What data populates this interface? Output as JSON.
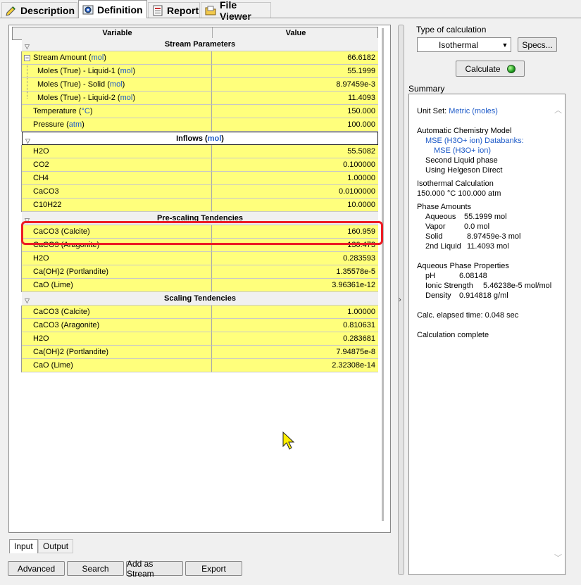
{
  "tabs": [
    {
      "label": "Description",
      "icon": "pencil-tag-icon"
    },
    {
      "label": "Definition",
      "icon": "gear-icon"
    },
    {
      "label": "Report",
      "icon": "report-icon"
    },
    {
      "label": "File Viewer",
      "icon": "folder-icon"
    }
  ],
  "grid": {
    "col_variable": "Variable",
    "col_value": "Value",
    "stream_section": "Stream Parameters",
    "stream_rows": [
      {
        "label": "Stream Amount",
        "unit": "mol",
        "value": "66.6182"
      },
      {
        "label": "Moles (True) - Liquid-1",
        "unit": "mol",
        "value": "55.1999"
      },
      {
        "label": "Moles (True) - Solid",
        "unit": "mol",
        "value": "8.97459e-3"
      },
      {
        "label": "Moles (True) - Liquid-2",
        "unit": "mol",
        "value": "11.4093"
      },
      {
        "label": "Temperature",
        "unit": "°C",
        "value": "150.000"
      },
      {
        "label": "Pressure",
        "unit": "atm",
        "value": "100.000"
      }
    ],
    "inflows_section": "Inflows",
    "inflows_unit": "mol",
    "inflows_rows": [
      {
        "label": "H2O",
        "value": "55.5082"
      },
      {
        "label": "CO2",
        "value": "0.100000"
      },
      {
        "label": "CH4",
        "value": "1.00000"
      },
      {
        "label": "CaCO3",
        "value": "0.0100000"
      },
      {
        "label": "C10H22",
        "value": "10.0000"
      }
    ],
    "prescaling_section": "Pre-scaling Tendencies",
    "prescaling_rows": [
      {
        "label": "CaCO3 (Calcite)",
        "value": "160.959"
      },
      {
        "label": "CaCO3 (Aragonite)",
        "value": "130.473"
      },
      {
        "label": "H2O",
        "value": "0.283593"
      },
      {
        "label": "Ca(OH)2 (Portlandite)",
        "value": "1.35578e-5"
      },
      {
        "label": "CaO (Lime)",
        "value": "3.96361e-12"
      }
    ],
    "scaling_section": "Scaling Tendencies",
    "scaling_rows": [
      {
        "label": "CaCO3 (Calcite)",
        "value": "1.00000"
      },
      {
        "label": "CaCO3 (Aragonite)",
        "value": "0.810631"
      },
      {
        "label": "H2O",
        "value": "0.283681"
      },
      {
        "label": "Ca(OH)2 (Portlandite)",
        "value": "7.94875e-8"
      },
      {
        "label": "CaO (Lime)",
        "value": "2.32308e-14"
      }
    ]
  },
  "bottom_tabs": {
    "input": "Input",
    "output": "Output"
  },
  "buttons": {
    "advanced": "Advanced",
    "search": "Search",
    "add_stream": "Add as Stream",
    "export": "Export"
  },
  "right": {
    "type_label": "Type of calculation",
    "type_value": "Isothermal",
    "specs": "Specs...",
    "calculate": "Calculate",
    "summary_label": "Summary"
  },
  "summary": {
    "unit_set_label": "Unit Set:",
    "unit_set_value": "Metric (moles)",
    "chem_model": "Automatic Chemistry Model",
    "databank_1": "MSE (H3O+ ion) Databanks:",
    "databank_2": "MSE (H3O+ ion)",
    "second_liquid": "Second Liquid phase",
    "helgeson": "Using Helgeson Direct",
    "iso_calc": "Isothermal Calculation",
    "conditions": "150.000 °C 100.000 atm",
    "phase_amounts": "Phase Amounts",
    "phases": [
      {
        "name": "Aqueous",
        "value": "55.1999 mol"
      },
      {
        "name": "Vapor",
        "value": "0.0 mol"
      },
      {
        "name": "Solid",
        "value": "8.97459e-3 mol"
      },
      {
        "name": "2nd Liquid",
        "value": "11.4093 mol"
      }
    ],
    "aq_props": "Aqueous Phase Properties",
    "props": [
      {
        "name": "pH",
        "value": "6.08148"
      },
      {
        "name": "Ionic Strength",
        "value": "5.46238e-5 mol/mol"
      },
      {
        "name": "Density",
        "value": "0.914818 g/ml"
      }
    ],
    "elapsed": "Calc. elapsed time: 0.048 sec",
    "complete": "Calculation complete"
  },
  "colors": {
    "cell_yellow": "#ffff7c",
    "unit_blue": "#1d5ac8",
    "highlight_red": "#ec1c24",
    "led_green": "#1f9d1f"
  }
}
